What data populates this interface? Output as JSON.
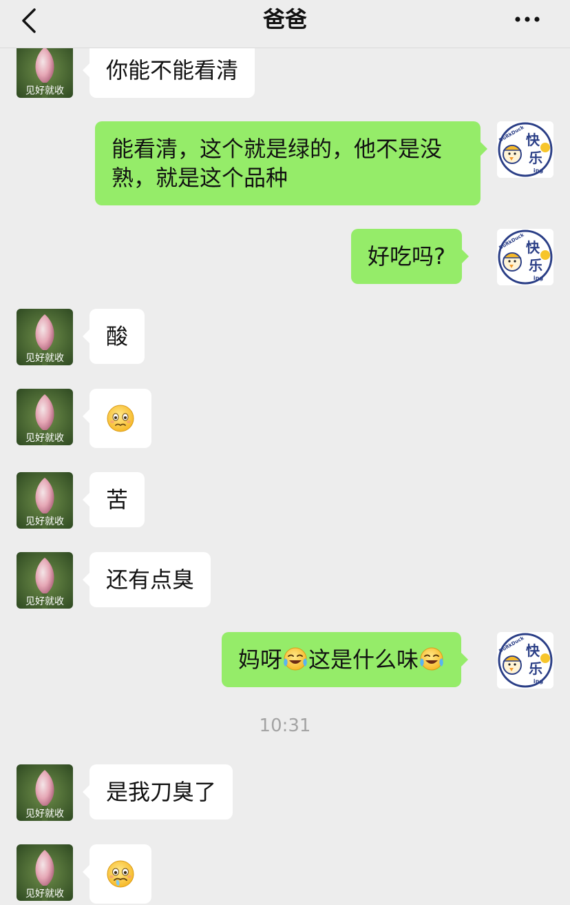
{
  "header": {
    "title": "爸爸",
    "back_icon": "chevron-left-icon",
    "more_icon": "ellipsis-icon"
  },
  "contact": {
    "avatar_caption": "见好就收"
  },
  "me": {
    "avatar_lines": [
      "快",
      "乐"
    ],
    "avatar_brand": "DuRkDuck",
    "avatar_suffix": "ing"
  },
  "messages": [
    {
      "side": "left",
      "text": "你能不能看清"
    },
    {
      "side": "right",
      "text": "能看清，这个就是绿的，他不是没熟，就是这个品种"
    },
    {
      "side": "right",
      "text": "好吃吗?"
    },
    {
      "side": "left",
      "text": "酸"
    },
    {
      "side": "left",
      "emoji": "worried-face-icon"
    },
    {
      "side": "left",
      "text": "苦"
    },
    {
      "side": "left",
      "text": "还有点臭"
    },
    {
      "side": "right",
      "parts": [
        "妈呀",
        "这是什么味"
      ],
      "emoji": "tears-of-joy-icon"
    },
    {
      "side": "left",
      "text": "是我刀臭了"
    },
    {
      "side": "left",
      "emoji": "sweating-face-icon"
    }
  ],
  "timestamp": "10:31",
  "colors": {
    "background": "#ededed",
    "my_bubble": "#95ec69",
    "their_bubble": "#ffffff",
    "timestamp": "#a3a3a3"
  }
}
